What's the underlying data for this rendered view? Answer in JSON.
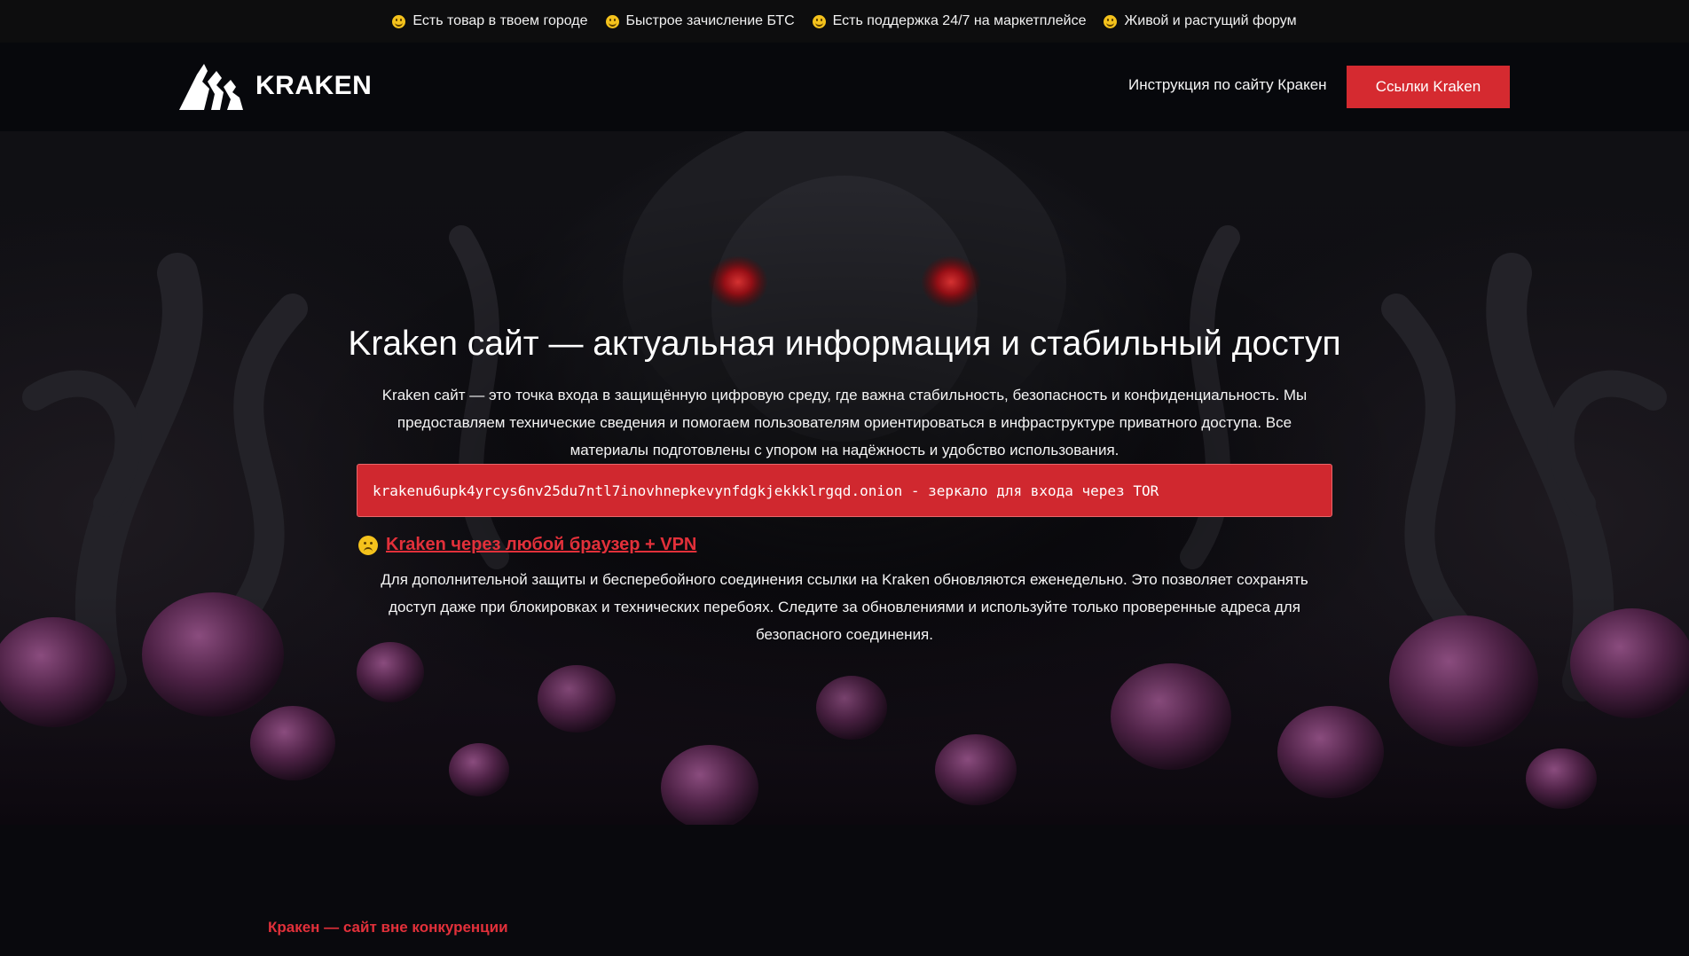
{
  "topbar": {
    "items": [
      "Есть товар в твоем городе",
      "Быстрое зачисление БТС",
      "Есть поддержка 24/7 на маркетплейсе",
      "Живой и растущий форум"
    ]
  },
  "header": {
    "logo_text": "KRAKEN",
    "nav_link": "Инструкция по сайту Кракен",
    "cta_label": "Ссылки Kraken"
  },
  "hero": {
    "title": "Kraken сайт — актуальная информация и стабильный доступ",
    "description": "Kraken сайт — это точка входа в защищённую цифровую среду, где важна стабильность, безопасность и конфиденциальность. Мы предоставляем технические сведения и помогаем пользователям ориентироваться в инфраструктуре приватного доступа. Все материалы подготовлены с упором на надёжность и удобство использования.",
    "mirror": "krakenu6upk4yrcys6nv25du7ntl7inovhnepkevynfdgkjekkklrgqd.onion - зеркало для входа через TOR",
    "vpn_link": "Kraken через любой браузер + VPN",
    "vpn_description": "Для дополнительной защиты и бесперебойного соединения ссылки на Kraken обновляются еженедельно. Это позволяет сохранять доступ даже при блокировках и технических перебоях. Следите за обновлениями и используйте только проверенные адреса для безопасного соединения."
  },
  "section": {
    "title": "Кракен — сайт вне конкуренции"
  },
  "colors": {
    "accent": "#d52a30",
    "link": "#e2303a",
    "background": "#0b0b0f"
  },
  "icons": {
    "topbar": "smile-emoji-icon",
    "vpn": "upside-down-face-icon",
    "logo": "kraken-logo-icon"
  }
}
